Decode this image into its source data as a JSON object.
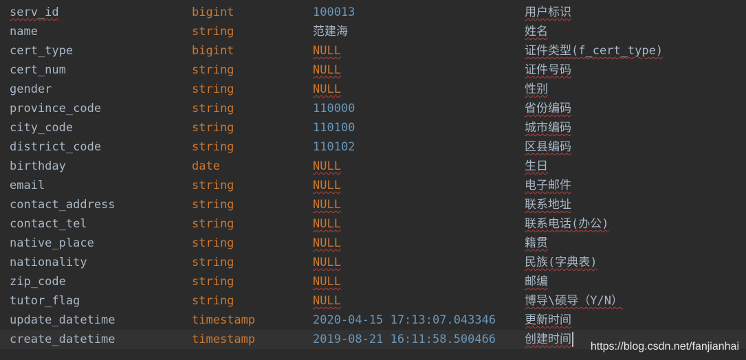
{
  "rows": [
    {
      "name": "serv_id",
      "type": "bigint",
      "value": "100013",
      "value_kind": "number",
      "comment": "用户标识"
    },
    {
      "name": "name",
      "type": "string",
      "value": "范建海",
      "value_kind": "text",
      "comment": "姓名"
    },
    {
      "name": "cert_type",
      "type": "bigint",
      "value": "NULL",
      "value_kind": "null",
      "comment": "证件类型(f_cert_type)"
    },
    {
      "name": "cert_num",
      "type": "string",
      "value": "NULL",
      "value_kind": "null",
      "comment": "证件号码"
    },
    {
      "name": "gender",
      "type": "string",
      "value": "NULL",
      "value_kind": "null",
      "comment": "性别"
    },
    {
      "name": "province_code",
      "type": "string",
      "value": "110000",
      "value_kind": "number",
      "comment": "省份编码"
    },
    {
      "name": "city_code",
      "type": "string",
      "value": "110100",
      "value_kind": "number",
      "comment": "城市编码"
    },
    {
      "name": "district_code",
      "type": "string",
      "value": "110102",
      "value_kind": "number",
      "comment": "区县编码"
    },
    {
      "name": "birthday",
      "type": "date",
      "value": "NULL",
      "value_kind": "null",
      "comment": "生日"
    },
    {
      "name": "email",
      "type": "string",
      "value": "NULL",
      "value_kind": "null",
      "comment": "电子邮件"
    },
    {
      "name": "contact_address",
      "type": "string",
      "value": "NULL",
      "value_kind": "null",
      "comment": "联系地址"
    },
    {
      "name": "contact_tel",
      "type": "string",
      "value": "NULL",
      "value_kind": "null",
      "comment": "联系电话(办公)"
    },
    {
      "name": "native_place",
      "type": "string",
      "value": "NULL",
      "value_kind": "null",
      "comment": "籍贯"
    },
    {
      "name": "nationality",
      "type": "string",
      "value": "NULL",
      "value_kind": "null",
      "comment": "民族(字典表)"
    },
    {
      "name": "zip_code",
      "type": "string",
      "value": "NULL",
      "value_kind": "null",
      "comment": "邮编"
    },
    {
      "name": "tutor_flag",
      "type": "string",
      "value": "NULL",
      "value_kind": "null",
      "comment": "博导\\硕导（Y/N）"
    },
    {
      "name": "update_datetime",
      "type": "timestamp",
      "value": "2020-04-15 17:13:07.043346",
      "value_kind": "number",
      "comment": "更新时间"
    },
    {
      "name": "create_datetime",
      "type": "timestamp",
      "value": "2019-08-21 16:11:58.500466",
      "value_kind": "number",
      "comment": "创建时间"
    }
  ],
  "current_row_index": 17,
  "watermark": "https://blog.csdn.net/fanjianhai",
  "colors": {
    "background": "#2b2b2b",
    "identifier": "#a9b7c6",
    "keyword": "#cc7832",
    "number": "#6897bb",
    "current_line": "#323232",
    "typo_underline": "#bc3f3c"
  }
}
